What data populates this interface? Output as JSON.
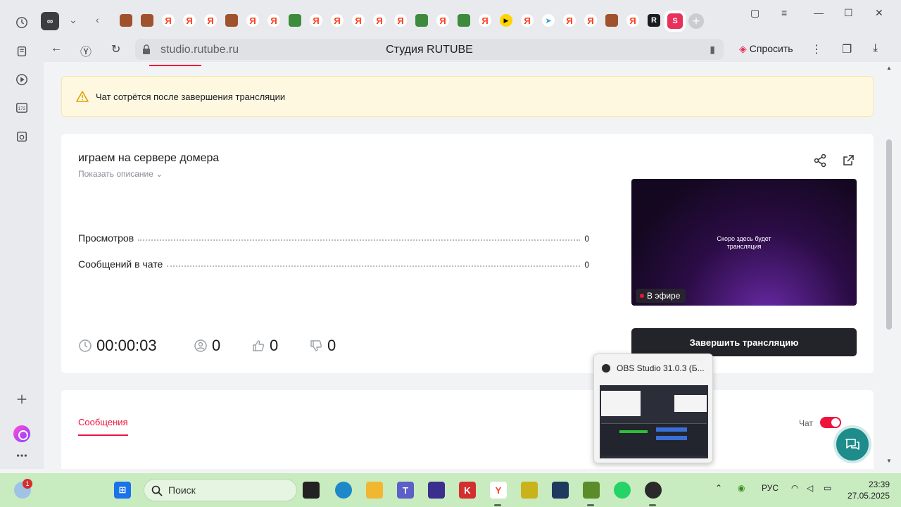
{
  "browser": {
    "url": "studio.rutube.ru",
    "title": "Студия RUTUBE",
    "ask_label": "Спросить",
    "new_tab": "+",
    "sidebar_badge": "172"
  },
  "warning": {
    "text": "Чат сотрётся после завершения трансляции"
  },
  "stream": {
    "title": "играем на сервере домера",
    "show_description": "Показать описание",
    "stats": [
      {
        "label": "Просмотров",
        "value": "0"
      },
      {
        "label": "Сообщений в чате",
        "value": "0"
      }
    ],
    "player_text_line1": "Скоро здесь будет",
    "player_text_line2": "трансляция",
    "live_label": "В эфире",
    "end_button": "Завершить трансляцию",
    "duration": "00:00:03",
    "viewers": "0",
    "likes": "0",
    "dislikes": "0"
  },
  "messages": {
    "tab_label": "Сообщения",
    "chat_label": "Чат",
    "chat_enabled": true
  },
  "obs_preview": {
    "title": "OBS Studio 31.0.3 (Б..."
  },
  "taskbar": {
    "search_placeholder": "Поиск",
    "language": "РУС",
    "time": "23:39",
    "date": "27.05.2025",
    "notification_count": "1"
  },
  "colors": {
    "accent": "#ed143b",
    "warning_bg": "#fff8e1",
    "end_button_bg": "#222429",
    "taskbar_bg": "#c8ebc0"
  }
}
